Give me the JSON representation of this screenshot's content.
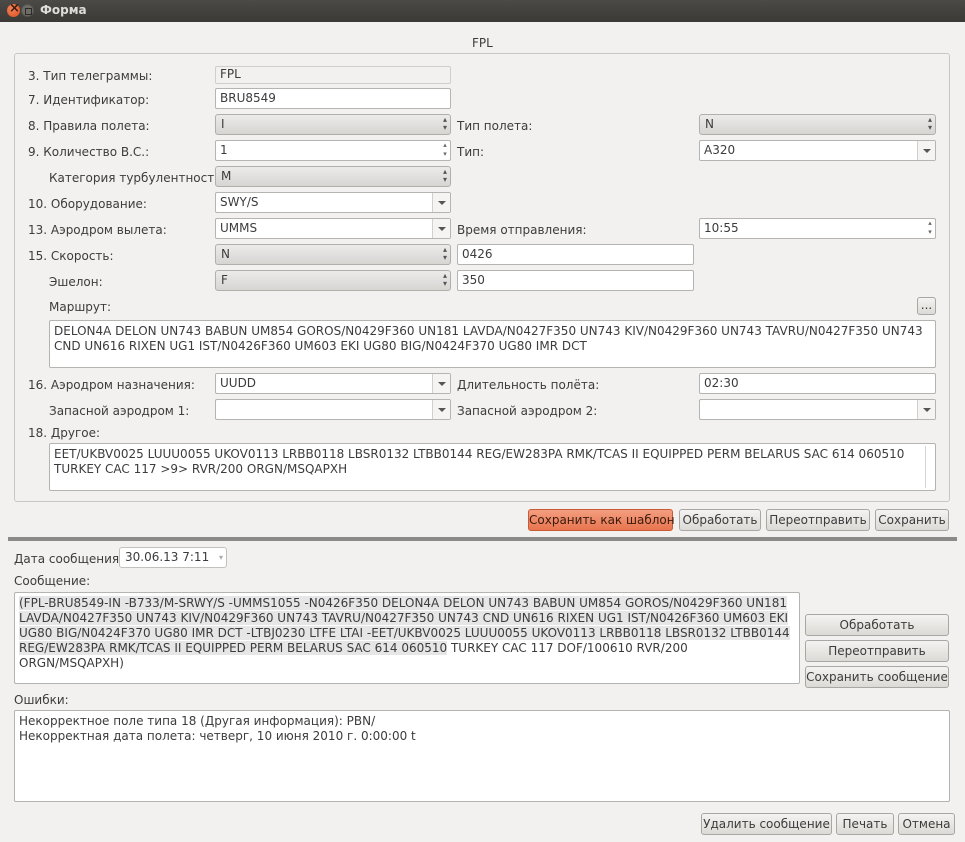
{
  "window": {
    "title": "Форма"
  },
  "form": {
    "header": "FPL",
    "type_label": "3.  Тип телеграммы:",
    "type_value": "FPL",
    "id_label": "7.  Идентификатор:",
    "id_value": "BRU8549",
    "rules_label": "8.  Правила полета:",
    "rules_value": "I",
    "flight_type_label": "Тип полета:",
    "flight_type_value": "N",
    "count_label": "9.  Количество В.С.:",
    "count_value": "1",
    "ac_type_label": "Тип:",
    "ac_type_value": "A320",
    "turb_label": "Категория турбулентности:",
    "turb_value": "M",
    "equip_label": "10. Оборудование:",
    "equip_value": "SWY/S",
    "dep_label": "13. Аэродром вылета:",
    "dep_value": "UMMS",
    "dep_time_label": "Время отправления:",
    "dep_time_value": "10:55",
    "speed_label": "15. Скорость:",
    "speed_unit": "N",
    "speed_value": "0426",
    "level_label": "Эшелон:",
    "level_unit": "F",
    "level_value": "350",
    "route_label": "Маршрут:",
    "route_button": "...",
    "route_value": "DELON4A DELON UN743 BABUN UM854 GOROS/N0429F360 UN181 LAVDA/N0427F350 UN743 KIV/N0429F360 UN743 TAVRU/N0427F350 UN743 CND UN616 RIXEN UG1 IST/N0426F360 UM603 EKI UG80 BIG/N0424F370 UG80 IMR DCT",
    "dest_label": "16. Аэродром назначения:",
    "dest_value": "UUDD",
    "duration_label": "Длительность полёта:",
    "duration_value": "02:30",
    "alt1_label": "Запасной аэродром 1:",
    "alt1_value": "",
    "alt2_label": "Запасной аэродром 2:",
    "alt2_value": "",
    "other_label": "18. Другое:",
    "other_value": "EET/UKBV0025 LUUU0055 UKOV0113 LRBB0118 LBSR0132 LTBB0144 REG/EW283PA RMK/TCAS II EQUIPPED PERM BELARUS SAC 614 060510 TURKEY CAC 117 >9> RVR/200 ORGN/MSQAPXH"
  },
  "form_buttons": {
    "save_template": "Сохранить как шаблон",
    "process": "Обработать",
    "resend": "Переотправить",
    "save": "Сохранить"
  },
  "message": {
    "date_label": "Дата сообщения:",
    "date_value": "30.06.13 7:11",
    "label": "Сообщение:",
    "text_hl": "(FPL-BRU8549-IN -B733/M-SRWY/S -UMMS1055 -N0426F350 DELON4A DELON UN743 BABUN UM854 GOROS/N0429F360 UN181 LAVDA/N0427F350 UN743 KIV/N0429F360 UN743 TAVRU/N0427F350 UN743 CND UN616 RIXEN UG1 IST/N0426F360 UM603 EKI UG80 BIG/N0424F370 UG80 IMR DCT -LTBJ0230 LTFE LTAI -EET/UKBV0025 LUUU0055 UKOV0113 LRBB0118 LBSR0132 LTBB0144 REG/EW283PA RMK/TCAS II EQUIPPED PERM BELARUS SAC 614 060510",
    "text_rest": " TURKEY CAC 117 DOF/100610 RVR/200 ORGN/MSQAPXH)",
    "process": "Обработать",
    "resend": "Переотправить",
    "save_message": "Сохранить сообщение"
  },
  "errors": {
    "label": "Ошибки:",
    "lines": [
      "Некорректное поле типа 18 (Другая информация): PBN/",
      "Некорректная дата полета: четверг, 10 июня 2010 г. 0:00:00 t"
    ]
  },
  "bottom_buttons": {
    "delete": "Удалить сообщение",
    "print": "Печать",
    "cancel": "Отмена"
  }
}
